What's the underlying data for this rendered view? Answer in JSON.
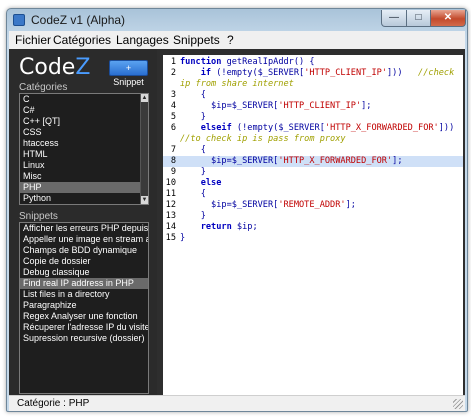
{
  "window": {
    "title": "CodeZ v1 (Alpha)"
  },
  "window_controls": {
    "minimize": "—",
    "maximize": "□",
    "close": "✕"
  },
  "menu": [
    "Fichier",
    "Catégories",
    "Langages",
    "Snippets",
    "?"
  ],
  "sidebar": {
    "logo_prefix": "Code",
    "logo_suffix": "Z",
    "add_button": "+ Snippet",
    "categories_label": "Catégories",
    "categories": [
      "C",
      "C#",
      "C++ [QT]",
      "CSS",
      "htaccess",
      "HTML",
      "Linux",
      "Misc",
      "PHP",
      "Python"
    ],
    "selected_category": "PHP",
    "snippets_label": "Snippets",
    "snippets": [
      "Afficher les erreurs PHP depuis le c...",
      "Appeller une image en stream au l...",
      "Champs de BDD dynamique",
      "Copie de dossier",
      "Debug classique",
      "Find real IP address in PHP",
      "List files in a directory",
      "Paragraphize",
      "Regex Analyser une fonction",
      "Récuperer l'adresse IP du visiteur",
      "Supression recursive (dossier)"
    ],
    "selected_snippet": "Find real IP address in PHP"
  },
  "editor": {
    "highlighted_line": 8,
    "lines": [
      {
        "num": "1",
        "html": "<span class='kw'>function</span> getRealIpAddr() {"
      },
      {
        "num": "2",
        "html": "    <span class='kw'>if</span> (!empty($_SERVER[<span class='str'>'HTTP_CLIENT_IP'</span>]))   <span class='cmt'>//check</span>"
      },
      {
        "num": "",
        "html": "<span class='cmt'>ip from share internet</span>"
      },
      {
        "num": "3",
        "html": "    {"
      },
      {
        "num": "4",
        "html": "      $ip=$_SERVER[<span class='str'>'HTTP_CLIENT_IP'</span>];"
      },
      {
        "num": "5",
        "html": "    }"
      },
      {
        "num": "6",
        "html": "    <span class='kw'>elseif</span> (!empty($_SERVER[<span class='str'>'HTTP_X_FORWARDED_FOR'</span>]))"
      },
      {
        "num": "",
        "html": "<span class='cmt'>//to check ip is pass from proxy</span>"
      },
      {
        "num": "7",
        "html": "    {"
      },
      {
        "num": "8",
        "html": "      $ip=$_SERVER[<span class='str'>'HTTP_X_FORWARDED_FOR'</span>];"
      },
      {
        "num": "9",
        "html": "    }"
      },
      {
        "num": "10",
        "html": "    <span class='kw'>else</span>"
      },
      {
        "num": "11",
        "html": "    {"
      },
      {
        "num": "12",
        "html": "      $ip=$_SERVER[<span class='str'>'REMOTE_ADDR'</span>];"
      },
      {
        "num": "13",
        "html": "    }"
      },
      {
        "num": "14",
        "html": "    <span class='kw'>return</span> $ip;"
      },
      {
        "num": "15",
        "html": "}"
      }
    ]
  },
  "status": {
    "text": "Catégorie : PHP"
  }
}
